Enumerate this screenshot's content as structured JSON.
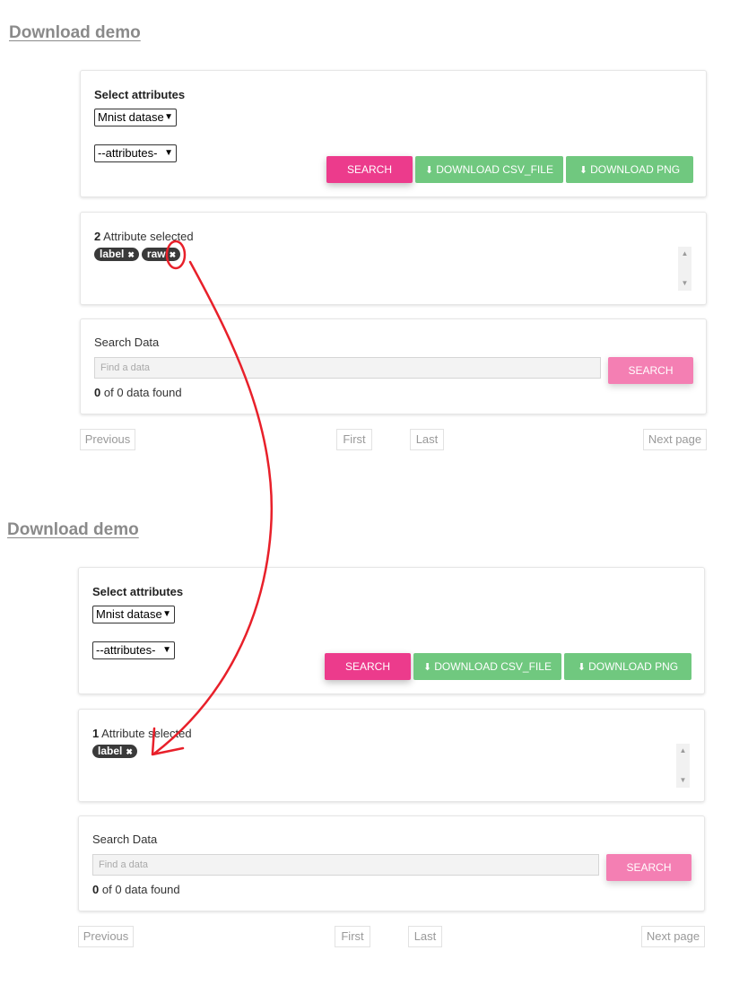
{
  "frames": [
    {
      "title": "Download demo",
      "select_section": {
        "label": "Select attributes",
        "dataset_value": "Mnist datase",
        "attributes_value": "--attributes-",
        "search_button": "SEARCH",
        "download_csv_button": "DOWNLOAD CSV_FILE",
        "download_png_button": "DOWNLOAD PNG"
      },
      "attributes_section": {
        "count": "2",
        "count_label": "Attribute selected",
        "tags": [
          "label",
          "raw"
        ]
      },
      "search_section": {
        "label": "Search Data",
        "input_placeholder": "Find a data",
        "search_button": "SEARCH",
        "found_count": "0",
        "found_text": "of 0 data found"
      },
      "pagination": {
        "previous": "Previous",
        "first": "First",
        "last": "Last",
        "next": "Next page"
      }
    },
    {
      "title": "Download demo",
      "select_section": {
        "label": "Select attributes",
        "dataset_value": "Mnist datase",
        "attributes_value": "--attributes-",
        "search_button": "SEARCH",
        "download_csv_button": "DOWNLOAD CSV_FILE",
        "download_png_button": "DOWNLOAD PNG"
      },
      "attributes_section": {
        "count": "1",
        "count_label": "Attribute selected",
        "tags": [
          "label"
        ]
      },
      "search_section": {
        "label": "Search Data",
        "input_placeholder": "Find a data",
        "search_button": "SEARCH",
        "found_count": "0",
        "found_text": "of 0 data found"
      },
      "pagination": {
        "previous": "Previous",
        "first": "First",
        "last": "Last",
        "next": "Next page"
      }
    }
  ],
  "icons": {
    "download": "download-icon",
    "tag_remove": "close-icon",
    "dropdown": "chevron-down-icon"
  },
  "colors": {
    "search_button": "#ec3b8c",
    "search_button_light": "#f47fb3",
    "download_button": "#70c87f",
    "tag_background": "#3a3a3a",
    "annotation": "#e8202a"
  }
}
